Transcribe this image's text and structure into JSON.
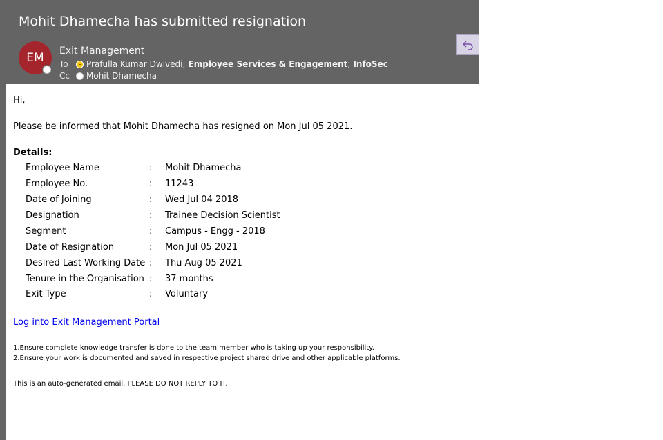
{
  "email": {
    "subject": "Mohit Dhamecha has submitted resignation",
    "sender": {
      "initials": "EM",
      "name": "Exit Management",
      "avatar_color": "#a4262c"
    },
    "to_label": "To",
    "to": [
      {
        "name": "Prafulla Kumar Dwivedi",
        "sep": ";",
        "status": "away"
      },
      {
        "name": "Employee Services & Engagement",
        "sep": ";",
        "bold": true
      },
      {
        "name": "InfoSec",
        "sep": "",
        "bold": true
      }
    ],
    "cc_label": "Cc",
    "cc": [
      {
        "name": "Mohit Dhamecha",
        "status": "offline"
      }
    ],
    "reply_icon": "reply-arrow-icon"
  },
  "body": {
    "greeting": "Hi,",
    "intro": "Please be informed that Mohit Dhamecha has resigned on Mon Jul 05 2021.",
    "details_label": "Details:",
    "separator": ":",
    "details": [
      {
        "label": "Employee Name",
        "value": "Mohit Dhamecha"
      },
      {
        "label": "Employee No.",
        "value": "11243"
      },
      {
        "label": "Date of Joining",
        "value": "Wed Jul 04 2018"
      },
      {
        "label": "Designation",
        "value": "Trainee Decision Scientist"
      },
      {
        "label": "Segment",
        "value": "Campus - Engg - 2018"
      },
      {
        "label": "Date of Resignation",
        "value": "Mon Jul 05 2021"
      },
      {
        "label": "Desired Last Working Date",
        "value": "Thu Aug 05 2021"
      },
      {
        "label": "Tenure in the Organisation",
        "value": "37 months"
      },
      {
        "label": "Exit Type",
        "value": "Voluntary"
      }
    ],
    "portal_link": "Log into Exit Management Portal",
    "notes": [
      "1.Ensure complete knowledge transfer is done to the team member who is taking up your responsibility.",
      "2.Ensure your work is documented and saved in respective project shared drive and other applicable platforms."
    ],
    "footer": "This is an auto-generated email. PLEASE DO NOT REPLY TO IT."
  }
}
